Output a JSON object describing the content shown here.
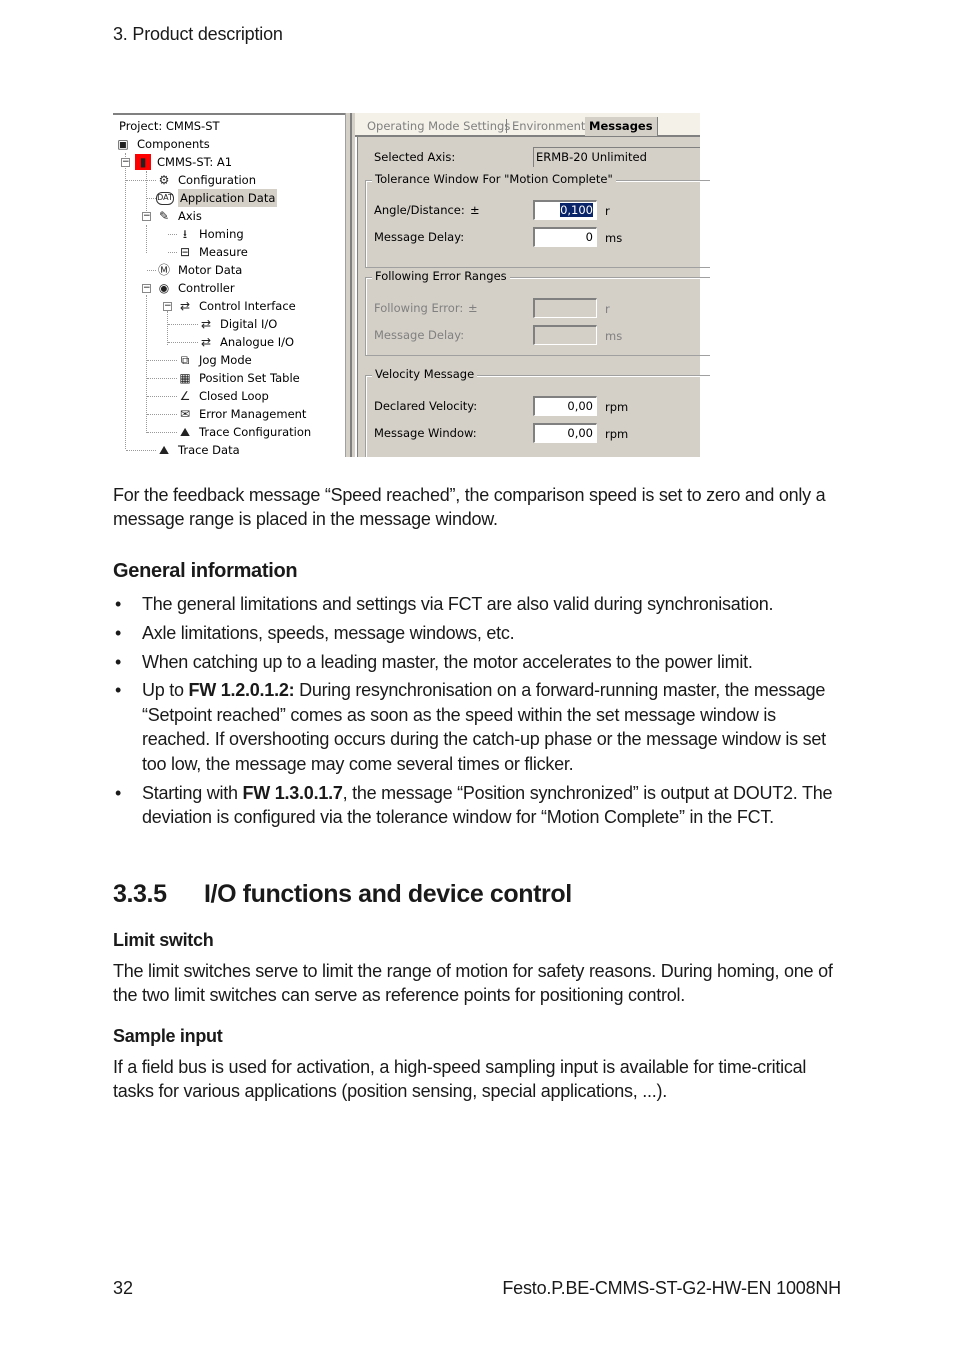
{
  "header": {
    "chapter": "3. Product description"
  },
  "screenshot": {
    "tree": {
      "project": "Project: CMMS-ST",
      "items": [
        {
          "label": "Components",
          "icon": "components-icon"
        },
        {
          "label": "CMMS-ST: A1",
          "icon": "device-icon"
        },
        {
          "label": "Configuration",
          "icon": "configuration-icon"
        },
        {
          "label": "Application Data",
          "icon": "data-icon",
          "selected": true
        },
        {
          "label": "Axis",
          "icon": "axis-icon"
        },
        {
          "label": "Homing",
          "icon": "homing-icon"
        },
        {
          "label": "Measure",
          "icon": "measure-icon"
        },
        {
          "label": "Motor Data",
          "icon": "motor-icon"
        },
        {
          "label": "Controller",
          "icon": "controller-icon"
        },
        {
          "label": "Control Interface",
          "icon": "interface-icon"
        },
        {
          "label": "Digital I/O",
          "icon": "io-icon"
        },
        {
          "label": "Analogue I/O",
          "icon": "io-icon"
        },
        {
          "label": "Jog Mode",
          "icon": "jog-icon"
        },
        {
          "label": "Position Set Table",
          "icon": "table-icon"
        },
        {
          "label": "Closed Loop",
          "icon": "loop-icon"
        },
        {
          "label": "Error Management",
          "icon": "envelope-icon"
        },
        {
          "label": "Trace Configuration",
          "icon": "trace-icon"
        },
        {
          "label": "Trace Data",
          "icon": "trace-icon"
        }
      ]
    },
    "tabs": [
      {
        "label": "Operating Mode Settings",
        "active": false
      },
      {
        "label": "Environment",
        "active": false
      },
      {
        "label": "Messages",
        "active": true
      }
    ],
    "selected_axis": {
      "label": "Selected Axis:",
      "value": "ERMB-20 Unlimited"
    },
    "tolerance": {
      "title": "Tolerance Window For \"Motion Complete\"",
      "angle_label": "Angle/Distance:",
      "plusminus": "±",
      "angle_value": "0,100",
      "angle_unit": "r",
      "delay_label": "Message Delay:",
      "delay_value": "0",
      "delay_unit": "ms"
    },
    "following": {
      "title": "Following Error Ranges",
      "error_label": "Following Error:",
      "plusminus": "±",
      "error_value": "",
      "error_unit": "r",
      "delay_label": "Message Delay:",
      "delay_value": "",
      "delay_unit": "ms"
    },
    "velocity": {
      "title": "Velocity Message",
      "declared_label": "Declared Velocity:",
      "declared_value": "0,00",
      "declared_unit": "rpm",
      "window_label": "Message Window:",
      "window_value": "0,00",
      "window_unit": "rpm"
    }
  },
  "intro_paragraph": "For the feedback message “Speed reached”, the comparison speed is set to zero and only a message range is placed in the message window.",
  "general": {
    "title": "General information",
    "bullets": [
      {
        "pre": "The general limitations and settings via FCT are also valid during synchronisation.",
        "bold": "",
        "post": ""
      },
      {
        "pre": "Axle limitations, speeds, message windows, etc.",
        "bold": "",
        "post": ""
      },
      {
        "pre": "When catching up to a leading master, the motor accelerates to the power limit.",
        "bold": "",
        "post": ""
      },
      {
        "pre": "Up to ",
        "bold": "FW 1.2.0.1.2:",
        "post": " During resynchronisation on a forward-running master, the message “Setpoint reached” comes as soon as the speed within the set message window is reached. If overshooting occurs during the catch-up phase or the message window is set too low, the message may come several times or flicker."
      },
      {
        "pre": "Starting with ",
        "bold": "FW 1.3.0.1.7",
        "post": ", the message “Position synchronized” is output at DOUT2. The deviation is configured via the tolerance window for “Motion Complete” in the FCT."
      }
    ],
    "bullet_char": "•"
  },
  "section": {
    "number": "3.3.5",
    "title": "I/O functions and device control",
    "limit_switch": {
      "title": "Limit switch",
      "text": "The limit switches serve to limit the range of motion for safety reasons. During homing, one of the two limit switches can serve as reference points for positioning control."
    },
    "sample_input": {
      "title": "Sample input",
      "text": "If a field bus is used for activation, a high-speed sampling input is available for time-critical tasks for various applications (position sensing, special applications, ...)."
    }
  },
  "footer": {
    "page": "32",
    "doc_id": "Festo.P.BE-CMMS-ST-G2-HW-EN 1008NH"
  }
}
